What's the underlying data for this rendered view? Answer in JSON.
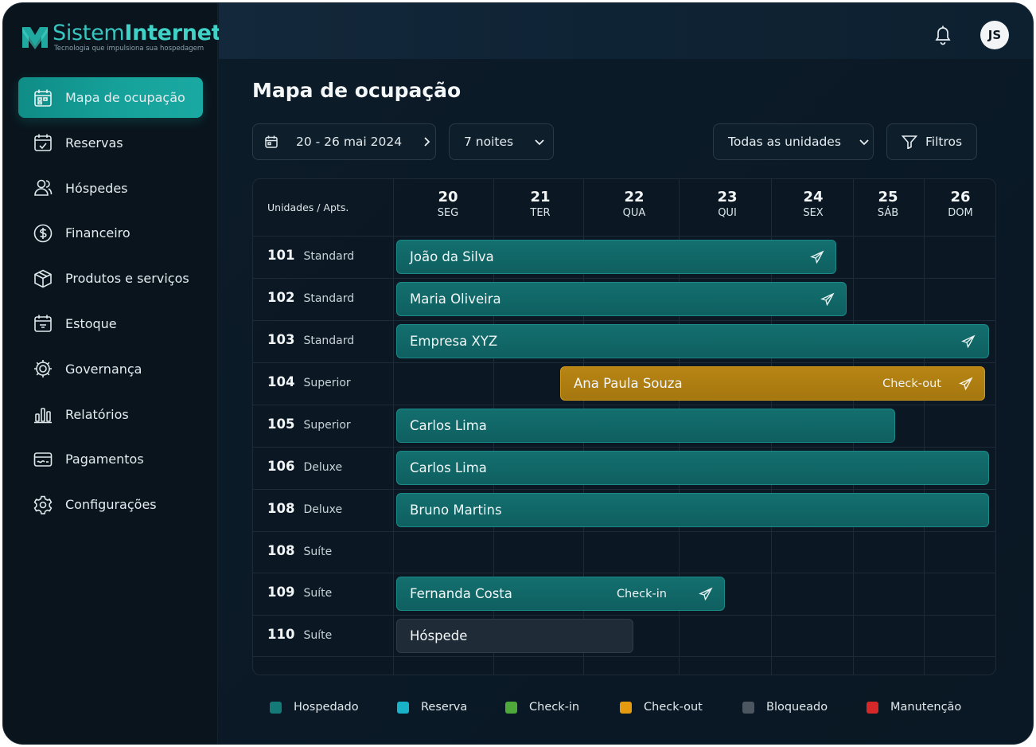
{
  "brand": {
    "name_part1": "Sistem",
    "name_part2": "Internet",
    "tagline": "Tecnologia que impulsiona sua hospedagem"
  },
  "sidebar": {
    "items": [
      {
        "label": "Mapa de ocupação",
        "icon": "calendar-grid-icon",
        "active": true
      },
      {
        "label": "Reservas",
        "icon": "calendar-icon"
      },
      {
        "label": "Hóspedes",
        "icon": "users-icon"
      },
      {
        "label": "Financeiro",
        "icon": "dollar-icon"
      },
      {
        "label": "Produtos e serviços",
        "icon": "box-icon"
      },
      {
        "label": "Estoque",
        "icon": "inventory-icon"
      },
      {
        "label": "Governança",
        "icon": "settings-gear-icon"
      },
      {
        "label": "Relatórios",
        "icon": "bar-chart-icon"
      },
      {
        "label": "Pagamentos",
        "icon": "payment-card-icon"
      },
      {
        "label": "Configurações",
        "icon": "gear-icon"
      }
    ]
  },
  "topbar": {
    "avatar_initials": "JS"
  },
  "page": {
    "title": "Mapa de ocupação"
  },
  "controls": {
    "date_range": "20 - 26 mai 2024",
    "nights": "7 noites",
    "units": "Todas as unidades",
    "filters": "Filtros"
  },
  "grid": {
    "header_label": "Unidades / Apts.",
    "days": [
      {
        "num": "20",
        "weekday": "SEG"
      },
      {
        "num": "21",
        "weekday": "TER"
      },
      {
        "num": "22",
        "weekday": "QUA"
      },
      {
        "num": "23",
        "weekday": "QUI"
      },
      {
        "num": "24",
        "weekday": "SEX"
      },
      {
        "num": "25",
        "weekday": "SÁB"
      },
      {
        "num": "26",
        "weekday": "DOM"
      }
    ],
    "rows": [
      {
        "unit": "101",
        "type": "Standard"
      },
      {
        "unit": "102",
        "type": "Standard"
      },
      {
        "unit": "103",
        "type": "Standard"
      },
      {
        "unit": "104",
        "type": "Superior"
      },
      {
        "unit": "105",
        "type": "Superior"
      },
      {
        "unit": "106",
        "type": "Deluxe"
      },
      {
        "unit": "108",
        "type": "Deluxe"
      },
      {
        "unit": "108",
        "type": "Suíte"
      },
      {
        "unit": "109",
        "type": "Suíte"
      },
      {
        "unit": "110",
        "type": "Suíte"
      }
    ],
    "bookings": [
      {
        "guest": "João da Silva",
        "status": "",
        "kind": "Hospedado"
      },
      {
        "guest": "Maria Oliveira",
        "status": "",
        "kind": "Hospedado"
      },
      {
        "guest": "Empresa XYZ",
        "status": "",
        "kind": "Hospedado"
      },
      {
        "guest": "Ana Paula Souza",
        "status": "Check-out",
        "kind": "Check-out"
      },
      {
        "guest": "Carlos Lima",
        "status": "",
        "kind": "Hospedado"
      },
      {
        "guest": "Carlos Lima",
        "status": "",
        "kind": "Hospedado"
      },
      {
        "guest": "Bruno Martins",
        "status": "",
        "kind": "Hospedado"
      },
      {
        "guest": "Fernanda Costa",
        "status": "Check-in",
        "kind": "Hospedado"
      },
      {
        "guest": "Hóspede",
        "status": "",
        "kind": "Bloqueado"
      }
    ]
  },
  "legend": [
    {
      "label": "Hospedado",
      "color": "#137a77"
    },
    {
      "label": "Reserva",
      "color": "#19b3c9"
    },
    {
      "label": "Check-in",
      "color": "#4ea83a"
    },
    {
      "label": "Check-out",
      "color": "#e59b0f"
    },
    {
      "label": "Bloqueado",
      "color": "#4b5660"
    },
    {
      "label": "Manutenção",
      "color": "#d62828"
    }
  ]
}
